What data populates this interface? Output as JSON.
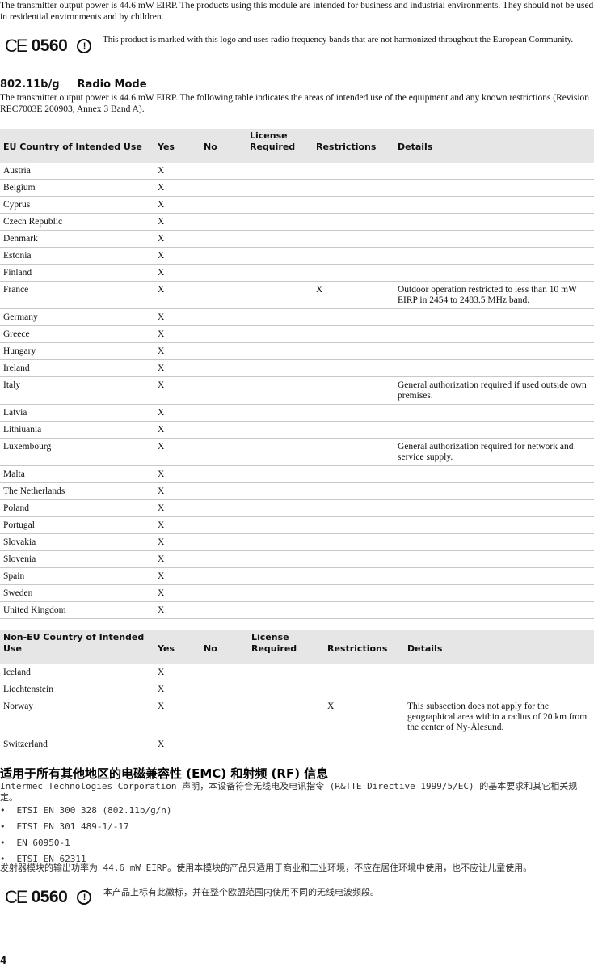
{
  "intro": "The transmitter output power is 44.6 mW EIRP. The products using this module are intended for business and industrial environments. They should not be used in residential environments and by children.",
  "ce_mark": {
    "symbol": "CE",
    "number": "0560",
    "alert": "!"
  },
  "ce_text": "This product is marked with this logo and uses radio frequency bands that are not harmonized throughout the European Community.",
  "section_title": "802.11b/g",
  "section_title2": "Radio Mode",
  "section_text": "The transmitter output power is 44.6 mW EIRP. The following table indicates the areas of intended use of the equipment and any known restrictions (Revision REC7003E 200903, Annex 3 Band A).",
  "eu_table": {
    "headers": [
      "EU Country of Intended Use",
      "Yes",
      "No",
      "License Required",
      "Restrictions",
      "Details"
    ],
    "rows": [
      [
        "Austria",
        "X",
        "",
        "",
        "",
        ""
      ],
      [
        "Belgium",
        "X",
        "",
        "",
        "",
        ""
      ],
      [
        "Cyprus",
        "X",
        "",
        "",
        "",
        ""
      ],
      [
        "Czech Republic",
        "X",
        "",
        "",
        "",
        ""
      ],
      [
        "Denmark",
        "X",
        "",
        "",
        "",
        ""
      ],
      [
        "Estonia",
        "X",
        "",
        "",
        "",
        ""
      ],
      [
        "Finland",
        "X",
        "",
        "",
        "",
        ""
      ],
      [
        "France",
        "X",
        "",
        "",
        "X",
        "Outdoor operation restricted to less than 10 mW EIRP in 2454 to 2483.5 MHz band."
      ],
      [
        "Germany",
        "X",
        "",
        "",
        "",
        ""
      ],
      [
        "Greece",
        "X",
        "",
        "",
        "",
        ""
      ],
      [
        "Hungary",
        "X",
        "",
        "",
        "",
        ""
      ],
      [
        "Ireland",
        "X",
        "",
        "",
        "",
        ""
      ],
      [
        "Italy",
        "X",
        "",
        "",
        "",
        "General authorization required if used outside own premises."
      ],
      [
        "Latvia",
        "X",
        "",
        "",
        "",
        ""
      ],
      [
        "Lithiuania",
        "X",
        "",
        "",
        "",
        ""
      ],
      [
        "Luxembourg",
        "X",
        "",
        "",
        "",
        "General authorization required for network and service supply."
      ],
      [
        "Malta",
        "X",
        "",
        "",
        "",
        ""
      ],
      [
        "The Netherlands",
        "X",
        "",
        "",
        "",
        ""
      ],
      [
        "Poland",
        "X",
        "",
        "",
        "",
        ""
      ],
      [
        "Portugal",
        "X",
        "",
        "",
        "",
        ""
      ],
      [
        "Slovakia",
        "X",
        "",
        "",
        "",
        ""
      ],
      [
        "Slovenia",
        "X",
        "",
        "",
        "",
        ""
      ],
      [
        "Spain",
        "X",
        "",
        "",
        "",
        ""
      ],
      [
        "Sweden",
        "X",
        "",
        "",
        "",
        ""
      ],
      [
        "United Kingdom",
        "X",
        "",
        "",
        "",
        ""
      ]
    ]
  },
  "noneu_table": {
    "headers": [
      "Non-EU Country of Intended Use",
      "Yes",
      "No",
      "License Required",
      "Restrictions",
      "Details"
    ],
    "rows": [
      [
        "Iceland",
        "X",
        "",
        "",
        "",
        ""
      ],
      [
        "Liechtenstein",
        "X",
        "",
        "",
        "",
        ""
      ],
      [
        "Norway",
        "X",
        "",
        "",
        "X",
        "This subsection does not apply for the geographical area within a radius of 20 km from the center of Ny-Ålesund."
      ],
      [
        "Switzerland",
        "X",
        "",
        "",
        "",
        ""
      ]
    ]
  },
  "cn_title": "适用于所有其他地区的电磁兼容性 (EMC) 和射频 (RF) 信息",
  "cn_text": "Intermec Technologies Corporation 声明，本设备符合无线电及电讯指令 (R&TTE Directive 1999/5/EC) 的基本要求和其它相关规定。",
  "cn_list": [
    "ETSI EN 300 328 (802.11b/g/n)",
    "ETSI EN 301 489-1/-17",
    "EN 60950-1",
    "ETSI EN 62311"
  ],
  "cn_power": "发射器模块的输出功率为 44.6 mW EIRP。使用本模块的产品只适用于商业和工业环境，不应在居住环境中使用，也不应让儿童使用。",
  "cn_ce_text": "本产品上标有此徽标，并在整个欧盟范围内使用不同的无线电波频段。",
  "page_number": "4"
}
